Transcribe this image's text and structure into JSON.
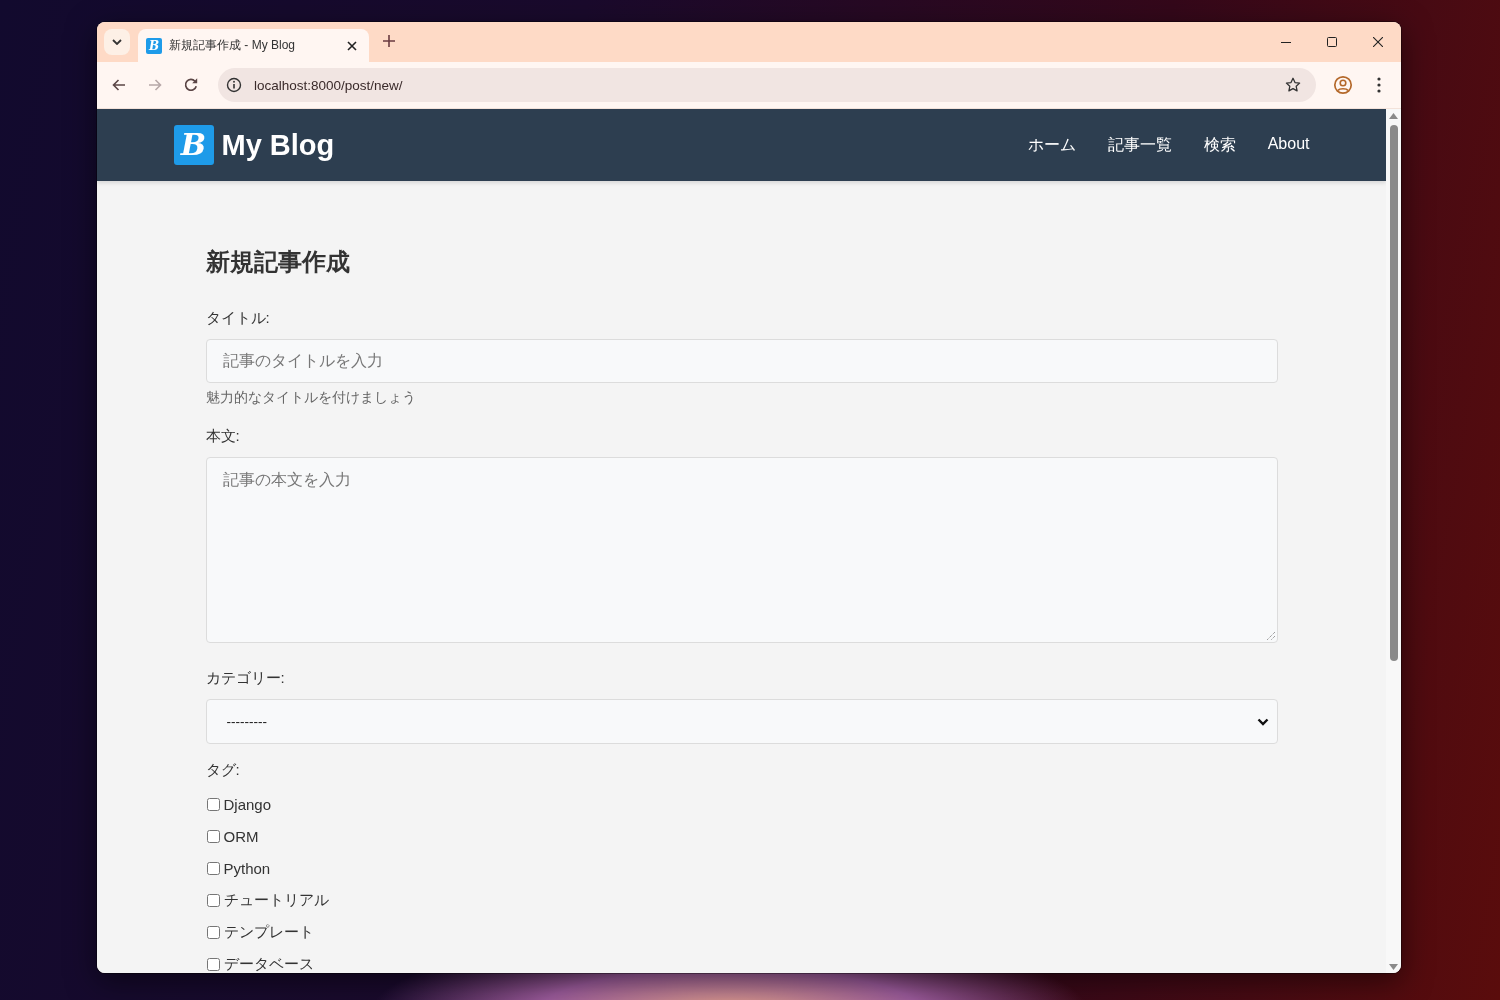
{
  "browser": {
    "tabs": [
      {
        "title": "新規記事作成 - My Blog",
        "favicon_letter": "B",
        "selected": true
      }
    ],
    "nav_buttons": [
      {
        "kind": "back",
        "disabled": false
      },
      {
        "kind": "forward",
        "disabled": true
      },
      {
        "kind": "reload",
        "disabled": false
      }
    ],
    "address": "localhost:8000/post/new/"
  },
  "site": {
    "logo_letter": "B",
    "name": "My Blog",
    "nav": [
      "ホーム",
      "記事一覧",
      "検索",
      "About"
    ]
  },
  "form": {
    "heading": "新規記事作成",
    "fields": [
      {
        "kind": "text",
        "label": "タイトル:",
        "placeholder": "記事のタイトルを入力",
        "help": "魅力的なタイトルを付けましょう"
      },
      {
        "kind": "textarea",
        "label": "本文:",
        "placeholder": "記事の本文を入力"
      },
      {
        "kind": "select",
        "label": "カテゴリー:",
        "value": "---------"
      },
      {
        "kind": "checkboxes",
        "label": "タグ:",
        "options": [
          {
            "label": "Django",
            "checked": false
          },
          {
            "label": "ORM",
            "checked": false
          },
          {
            "label": "Python",
            "checked": false
          },
          {
            "label": "チュートリアル",
            "checked": false
          },
          {
            "label": "テンプレート",
            "checked": false
          },
          {
            "label": "データベース",
            "checked": false
          }
        ]
      }
    ]
  }
}
